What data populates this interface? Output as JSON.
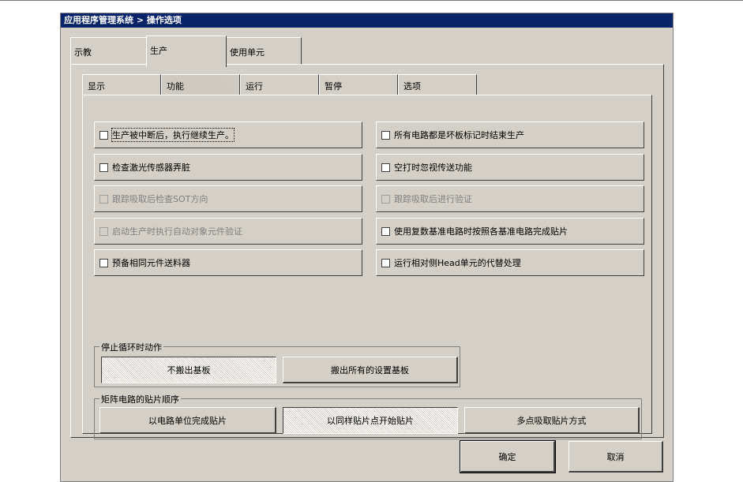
{
  "window": {
    "title": "应用程序管理系统 > 操作选项"
  },
  "outer_tabs": [
    {
      "label": "示教"
    },
    {
      "label": "生产"
    },
    {
      "label": "使用单元"
    }
  ],
  "inner_tabs": [
    {
      "label": "显示"
    },
    {
      "label": "功能"
    },
    {
      "label": "运行"
    },
    {
      "label": "暂停"
    },
    {
      "label": "选项"
    }
  ],
  "options_left": [
    {
      "label": "生产被中断后，执行继续生产。",
      "checked": false,
      "enabled": true
    },
    {
      "label": "检查激光传感器弄脏",
      "checked": false,
      "enabled": true
    },
    {
      "label": "跟踪吸取后检查SOT方向",
      "checked": false,
      "enabled": false
    },
    {
      "label": "启动生产时执行自动对象元件验证",
      "checked": false,
      "enabled": false
    },
    {
      "label": "预备相同元件送料器",
      "checked": false,
      "enabled": true
    }
  ],
  "options_right": [
    {
      "label": "所有电路都是坏板标记时结束生产",
      "checked": false,
      "enabled": true
    },
    {
      "label": "空打时忽视传送功能",
      "checked": false,
      "enabled": true
    },
    {
      "label": "跟踪吸取后进行验证",
      "checked": false,
      "enabled": false
    },
    {
      "label": "使用复数基准电路时按照各基准电路完成贴片",
      "checked": false,
      "enabled": true
    },
    {
      "label": "运行相对侧Head单元的代替处理",
      "checked": false,
      "enabled": true
    }
  ],
  "stop_group": {
    "title": "停止循环时动作",
    "buttons": [
      {
        "label": "不搬出基板",
        "selected": true
      },
      {
        "label": "搬出所有的设置基板",
        "selected": false
      }
    ]
  },
  "matrix_group": {
    "title": "矩阵电路的贴片顺序",
    "buttons": [
      {
        "label": "以电路单位完成贴片",
        "selected": false
      },
      {
        "label": "以同样贴片点开始贴片",
        "selected": true
      },
      {
        "label": "多点吸取贴片方式",
        "selected": false
      }
    ]
  },
  "footer": {
    "ok_label": "确定",
    "cancel_label": "取消"
  }
}
